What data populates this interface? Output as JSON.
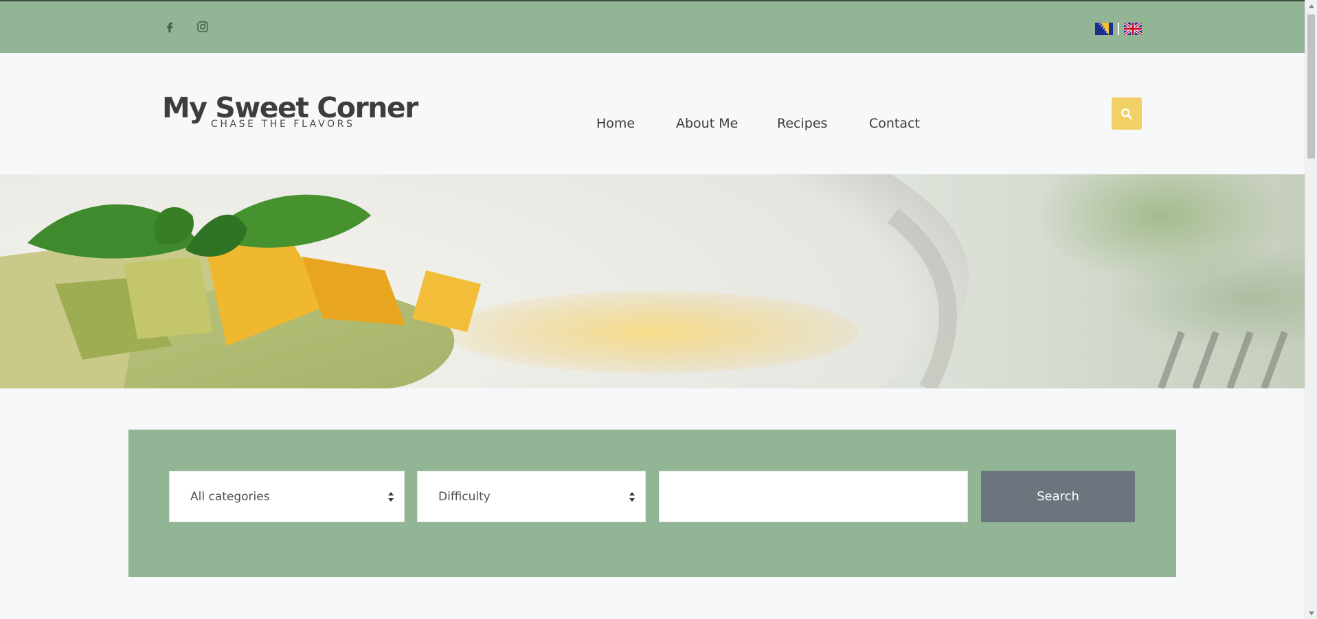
{
  "topbar": {
    "social": [
      {
        "icon": "facebook-icon"
      },
      {
        "icon": "instagram-icon"
      }
    ],
    "languages": [
      {
        "icon": "bosnia-flag-icon"
      },
      {
        "icon": "uk-flag-icon"
      }
    ]
  },
  "header": {
    "logo_title": "My Sweet Corner",
    "logo_tagline": "CHASE THE FLAVORS",
    "nav": {
      "home": "Home",
      "about": "About Me",
      "recipes": "Recipes",
      "contact": "Contact"
    },
    "search_icon": "search-icon"
  },
  "hero": {
    "image": "pasta-with-basil-photo"
  },
  "search_form": {
    "category_value": "All categories",
    "difficulty_value": "Difficulty",
    "keyword_value": "",
    "button_label": "Search"
  },
  "colors": {
    "topbar": "#92b596",
    "accent_search": "#f1d166",
    "button": "#6c757d",
    "background": "#f7f8fa"
  }
}
